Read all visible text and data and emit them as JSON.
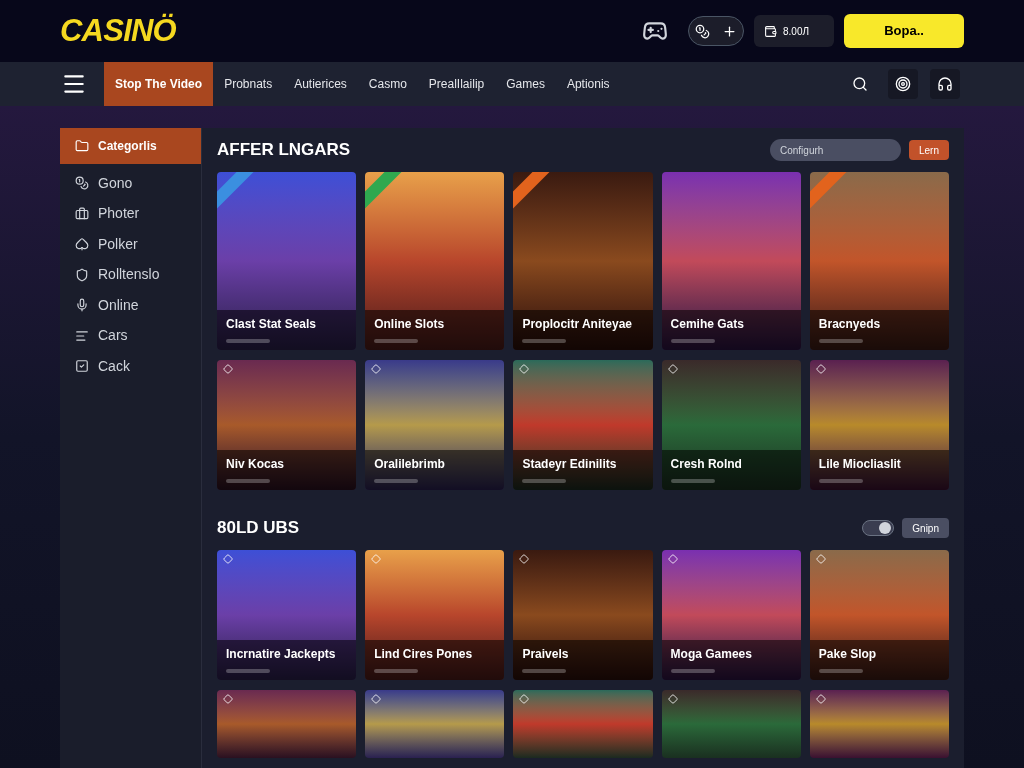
{
  "header": {
    "logo": "CASINÖ",
    "balance": "8.00Л",
    "cta": "Bopa.."
  },
  "nav": {
    "tabs": [
      {
        "label": "Stop The Video",
        "selected": true
      },
      {
        "label": "Probnats",
        "selected": false
      },
      {
        "label": "Autierices",
        "selected": false
      },
      {
        "label": "Casmo",
        "selected": false
      },
      {
        "label": "PrealIlailip",
        "selected": false
      },
      {
        "label": "Games",
        "selected": false
      },
      {
        "label": "Aptionis",
        "selected": false
      }
    ]
  },
  "sidebar": {
    "items": [
      {
        "label": "Categorlis",
        "selected": true
      },
      {
        "label": "Gono",
        "selected": false
      },
      {
        "label": "Photer",
        "selected": false
      },
      {
        "label": "Polker",
        "selected": false
      },
      {
        "label": "Rolltenslo",
        "selected": false
      },
      {
        "label": "Online",
        "selected": false
      },
      {
        "label": "Cars",
        "selected": false
      },
      {
        "label": "Cack",
        "selected": false
      }
    ]
  },
  "sections": [
    {
      "title": "AFFER LNGARS",
      "search": {
        "placeholder": "Configurh"
      },
      "button": "Lern",
      "rows": [
        [
          {
            "kind": "ribboned",
            "title": "Clast Stat Seals",
            "color": "#3b8fe0"
          },
          {
            "kind": "ribboned",
            "title": "Online Slots",
            "color": "#2fa84f"
          },
          {
            "kind": "ribboned",
            "title": "Proplocitr Aniteyae",
            "color": "#e2631d"
          },
          {
            "kind": "plain",
            "title": "Cemihe Gats"
          },
          {
            "kind": "ribboned",
            "title": "Bracnyeds",
            "color": "#e2631d"
          }
        ],
        [
          {
            "kind": "plain",
            "title": "Niv Kocas"
          },
          {
            "kind": "plain",
            "title": "Oralilebrimb"
          },
          {
            "kind": "plain",
            "title": "Stadeyr Edinilits"
          },
          {
            "kind": "plain",
            "title": "Cresh Rolnd"
          },
          {
            "kind": "plain",
            "title": "Lile Miocliaslit"
          }
        ]
      ]
    },
    {
      "title": "80LD UBS",
      "button": "Gnipn",
      "rows": [
        [
          {
            "kind": "plain",
            "title": "Incrnatire Jackepts"
          },
          {
            "kind": "plain",
            "title": "Lind Cires Pones"
          },
          {
            "kind": "plain",
            "title": "Praivels"
          },
          {
            "kind": "plain",
            "title": "Moga Gamees"
          },
          {
            "kind": "plain",
            "title": "Pake Slop"
          }
        ],
        [
          {
            "kind": "partial"
          },
          {
            "kind": "partial"
          },
          {
            "kind": "partial"
          },
          {
            "kind": "partial"
          },
          {
            "kind": "partial"
          }
        ]
      ]
    }
  ]
}
